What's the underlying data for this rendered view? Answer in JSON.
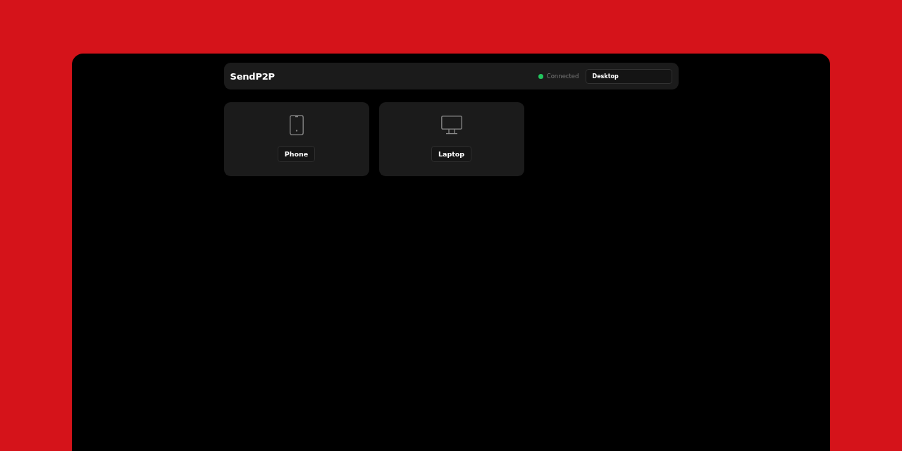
{
  "header": {
    "title": "SendP2P",
    "status": {
      "label": "Connected",
      "connected": true
    },
    "device_name": {
      "value": "Desktop"
    }
  },
  "devices": [
    {
      "kind": "phone",
      "label": "Phone"
    },
    {
      "kind": "desktop",
      "label": "Laptop"
    }
  ]
}
